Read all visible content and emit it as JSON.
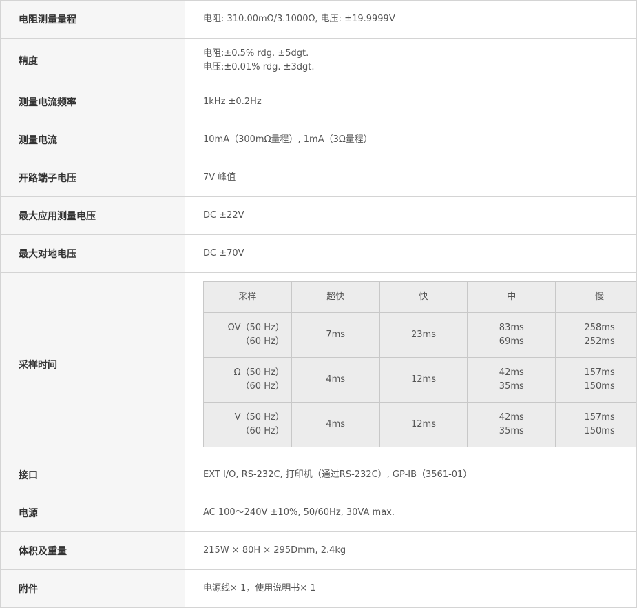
{
  "rows": [
    {
      "label": "电阻测量量程",
      "value": "电阻: 310.00mΩ/3.1000Ω, 电压: ±19.9999V"
    },
    {
      "label": "精度",
      "lines": [
        "电阻:±0.5% rdg. ±5dgt.",
        "电压:±0.01% rdg. ±3dgt."
      ]
    },
    {
      "label": "测量电流频率",
      "value": "1kHz ±0.2Hz"
    },
    {
      "label": "测量电流",
      "value": "10mA（300mΩ量程）, 1mA（3Ω量程）"
    },
    {
      "label": "开路端子电压",
      "value": "7V 峰值"
    },
    {
      "label": "最大应用测量电压",
      "value": "DC ±22V"
    },
    {
      "label": "最大对地电压",
      "value": "DC ±70V"
    },
    {
      "label": "采样时间"
    },
    {
      "label": "接口",
      "value": "EXT I/O, RS-232C, 打印机（通过RS-232C）, GP-IB（3561-01）"
    },
    {
      "label": "电源",
      "value": "AC 100～240V ±10%, 50/60Hz, 30VA max."
    },
    {
      "label": "体积及重量",
      "value": "215W × 80H × 295Dmm, 2.4kg"
    },
    {
      "label": "附件",
      "value": "电源线× 1，使用说明书× 1"
    }
  ],
  "sampling": {
    "headers": [
      "采样",
      "超快",
      "快",
      "中",
      "慢"
    ],
    "rows": [
      {
        "label": [
          "ΩV（50 Hz）",
          "（60 Hz）"
        ],
        "ultra_fast": "7ms",
        "fast": "23ms",
        "medium": [
          "83ms",
          "69ms"
        ],
        "slow": [
          "258ms",
          "252ms"
        ]
      },
      {
        "label": [
          "Ω（50 Hz）",
          "（60 Hz）"
        ],
        "ultra_fast": "4ms",
        "fast": "12ms",
        "medium": [
          "42ms",
          "35ms"
        ],
        "slow": [
          "157ms",
          "150ms"
        ]
      },
      {
        "label": [
          "V（50 Hz）",
          "（60 Hz）"
        ],
        "ultra_fast": "4ms",
        "fast": "12ms",
        "medium": [
          "42ms",
          "35ms"
        ],
        "slow": [
          "157ms",
          "150ms"
        ]
      }
    ]
  }
}
